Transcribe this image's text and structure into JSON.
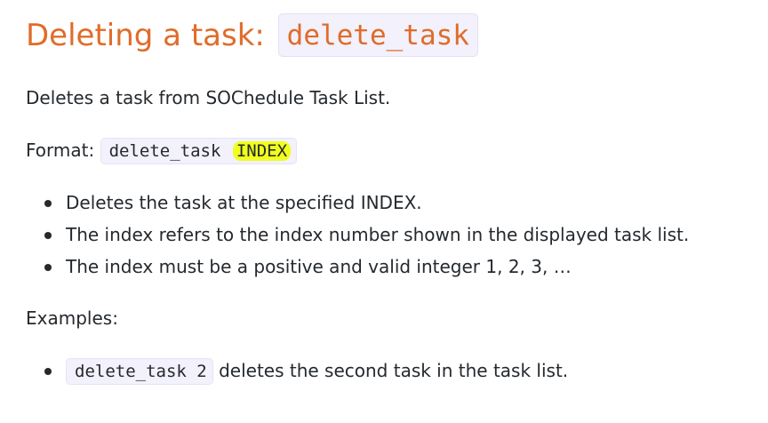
{
  "heading": {
    "text": "Deleting a task: ",
    "code": "delete_task"
  },
  "description": "Deletes a task from SOChedule Task List.",
  "format": {
    "label": "Format: ",
    "command": "delete_task ",
    "param": "INDEX"
  },
  "notes": [
    "Deletes the task at the specified INDEX.",
    "The index refers to the index number shown in the displayed task list.",
    "The index must be a positive and valid integer 1, 2, 3, …"
  ],
  "examples_label": "Examples:",
  "examples": [
    {
      "code": "delete_task 2",
      "text": " deletes the second task in the task list."
    }
  ],
  "colors": {
    "heading": "#e06c2a",
    "code_background": "#f2f1fc",
    "highlight": "#f0ff1f",
    "text": "#24292e"
  }
}
